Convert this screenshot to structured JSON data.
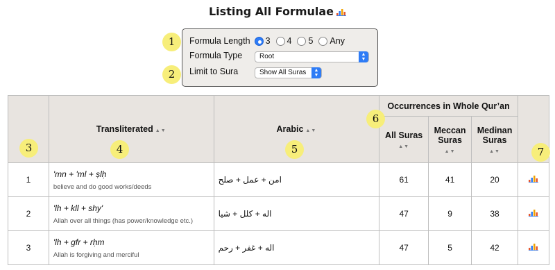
{
  "title": "Listing All Formulae",
  "filters": {
    "length_label": "Formula Length",
    "length_options": [
      "3",
      "4",
      "5",
      "Any"
    ],
    "length_selected": "3",
    "type_label": "Formula Type",
    "type_value": "Root",
    "sura_label": "Limit to Sura",
    "sura_value": "Show All Suras"
  },
  "callouts": [
    "1",
    "2",
    "3",
    "4",
    "5",
    "6",
    "7"
  ],
  "table": {
    "headers": {
      "transliterated": "Transliterated",
      "arabic": "Arabic",
      "occurrences": "Occurrences in Whole Qur’an",
      "all": "All Suras",
      "meccan": "Meccan Suras",
      "medinan": "Medinan Suras"
    },
    "rows": [
      {
        "n": "1",
        "translit": "'mn + 'ml + ṣlḥ",
        "gloss": "believe and do good works/deeds",
        "arabic": "امن + عمل + صلح",
        "all": "61",
        "meccan": "41",
        "medinan": "20"
      },
      {
        "n": "2",
        "translit": "'lh + kll + shy'",
        "gloss": "Allah over all things (has power/knowledge etc.)",
        "arabic": "اله + كلل + شيا",
        "all": "47",
        "meccan": "9",
        "medinan": "38"
      },
      {
        "n": "3",
        "translit": "'lh + gfr + rḥm",
        "gloss": "Allah is forgiving and merciful",
        "arabic": "اله + غفر + رحم",
        "all": "47",
        "meccan": "5",
        "medinan": "42"
      }
    ]
  },
  "colors": {
    "chart_bars": [
      "#e4572e",
      "#2e7cf6",
      "#f0a202",
      "#2e7cf6"
    ],
    "accent": "#2e7cf6",
    "callout": "#f7ee7a"
  }
}
